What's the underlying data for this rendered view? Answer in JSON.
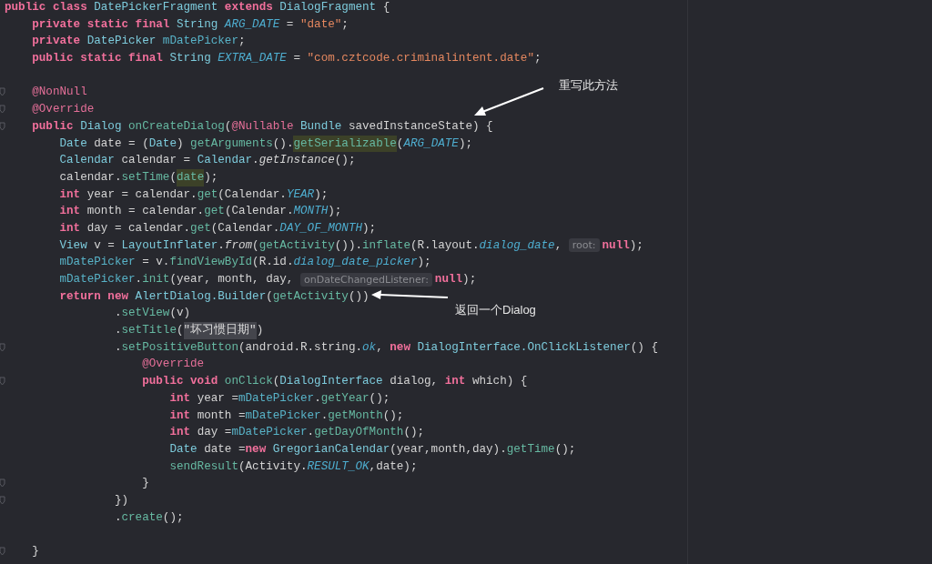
{
  "editor": {
    "lines": [
      {
        "fold": false,
        "tokens": [
          {
            "text": "public class ",
            "kind": "kw"
          },
          {
            "text": "DatePickerFragment ",
            "kind": "type"
          },
          {
            "text": "extends ",
            "kind": "kw"
          },
          {
            "text": "DialogFragment ",
            "kind": "type"
          },
          {
            "text": "{",
            "kind": "plain"
          }
        ]
      },
      {
        "fold": false,
        "tokens": [
          {
            "text": "    private static final ",
            "kind": "kw"
          },
          {
            "text": "String ",
            "kind": "type"
          },
          {
            "text": "ARG_DATE",
            "kind": "const"
          },
          {
            "text": " = ",
            "kind": "plain"
          },
          {
            "text": "\"date\"",
            "kind": "str"
          },
          {
            "text": ";",
            "kind": "plain"
          }
        ]
      },
      {
        "fold": false,
        "tokens": [
          {
            "text": "    private ",
            "kind": "kw"
          },
          {
            "text": "DatePicker ",
            "kind": "type"
          },
          {
            "text": "mDatePicker",
            "kind": "field"
          },
          {
            "text": ";",
            "kind": "plain"
          }
        ]
      },
      {
        "fold": false,
        "tokens": [
          {
            "text": "    public static final ",
            "kind": "kw"
          },
          {
            "text": "String ",
            "kind": "type"
          },
          {
            "text": "EXTRA_DATE",
            "kind": "const"
          },
          {
            "text": " = ",
            "kind": "plain"
          },
          {
            "text": "\"com.cztcode.criminalintent.date\"",
            "kind": "str"
          },
          {
            "text": ";",
            "kind": "plain"
          }
        ]
      },
      {
        "fold": false
      },
      {
        "fold": true,
        "tokens": [
          {
            "text": "    @NonNull",
            "kind": "anno"
          }
        ]
      },
      {
        "fold": true,
        "tokens": [
          {
            "text": "    @Override",
            "kind": "anno"
          }
        ]
      },
      {
        "fold": true,
        "tokens": [
          {
            "text": "    public ",
            "kind": "kw"
          },
          {
            "text": "Dialog ",
            "kind": "type"
          },
          {
            "text": "onCreateDialog",
            "kind": "fn"
          },
          {
            "text": "(",
            "kind": "plain"
          },
          {
            "text": "@Nullable ",
            "kind": "anno"
          },
          {
            "text": "Bundle ",
            "kind": "type"
          },
          {
            "text": "savedInstanceState) {",
            "kind": "plain"
          }
        ]
      },
      {
        "fold": false,
        "tokens": [
          {
            "text": "        Date ",
            "kind": "type"
          },
          {
            "text": "date = (",
            "kind": "plain"
          },
          {
            "text": "Date",
            "kind": "type"
          },
          {
            "text": ") ",
            "kind": "plain"
          },
          {
            "text": "getArguments",
            "kind": "fn"
          },
          {
            "text": "().",
            "kind": "plain"
          },
          {
            "text": "getSerializable",
            "kind": "match"
          },
          {
            "text": "(",
            "kind": "plain"
          },
          {
            "text": "ARG_DATE",
            "kind": "const"
          },
          {
            "text": ");",
            "kind": "plain"
          }
        ]
      },
      {
        "fold": false,
        "tokens": [
          {
            "text": "        Calendar ",
            "kind": "type"
          },
          {
            "text": "calendar = ",
            "kind": "plain"
          },
          {
            "text": "Calendar",
            "kind": "type"
          },
          {
            "text": ".",
            "kind": "plain"
          },
          {
            "text": "getInstance",
            "kind": "static"
          },
          {
            "text": "();",
            "kind": "plain"
          }
        ]
      },
      {
        "fold": false,
        "tokens": [
          {
            "text": "        calendar.",
            "kind": "plain"
          },
          {
            "text": "setTime",
            "kind": "fn"
          },
          {
            "text": "(",
            "kind": "plain"
          },
          {
            "text": "date",
            "kind": "match"
          },
          {
            "text": ");",
            "kind": "plain"
          }
        ]
      },
      {
        "fold": false,
        "tokens": [
          {
            "text": "        int ",
            "kind": "kw"
          },
          {
            "text": "year = calendar.",
            "kind": "plain"
          },
          {
            "text": "get",
            "kind": "fn"
          },
          {
            "text": "(Calendar.",
            "kind": "plain"
          },
          {
            "text": "YEAR",
            "kind": "const"
          },
          {
            "text": ");",
            "kind": "plain"
          }
        ]
      },
      {
        "fold": false,
        "tokens": [
          {
            "text": "        int ",
            "kind": "kw"
          },
          {
            "text": "month = calendar.",
            "kind": "plain"
          },
          {
            "text": "get",
            "kind": "fn"
          },
          {
            "text": "(Calendar.",
            "kind": "plain"
          },
          {
            "text": "MONTH",
            "kind": "const"
          },
          {
            "text": ");",
            "kind": "plain"
          }
        ]
      },
      {
        "fold": false,
        "tokens": [
          {
            "text": "        int ",
            "kind": "kw"
          },
          {
            "text": "day = calendar.",
            "kind": "plain"
          },
          {
            "text": "get",
            "kind": "fn"
          },
          {
            "text": "(Calendar.",
            "kind": "plain"
          },
          {
            "text": "DAY_OF_MONTH",
            "kind": "const"
          },
          {
            "text": ");",
            "kind": "plain"
          }
        ]
      },
      {
        "fold": false,
        "tokens": [
          {
            "text": "        View ",
            "kind": "type"
          },
          {
            "text": "v = ",
            "kind": "plain"
          },
          {
            "text": "LayoutInflater",
            "kind": "type"
          },
          {
            "text": ".",
            "kind": "plain"
          },
          {
            "text": "from",
            "kind": "static"
          },
          {
            "text": "(",
            "kind": "plain"
          },
          {
            "text": "getActivity",
            "kind": "fn"
          },
          {
            "text": "()).",
            "kind": "plain"
          },
          {
            "text": "inflate",
            "kind": "fn"
          },
          {
            "text": "(R.layout.",
            "kind": "plain"
          },
          {
            "text": "dialog_date",
            "kind": "const"
          },
          {
            "text": ", ",
            "kind": "plain"
          },
          {
            "text": "root:",
            "kind": "hint"
          },
          {
            "text": "null",
            "kind": "kw"
          },
          {
            "text": ");",
            "kind": "plain"
          }
        ]
      },
      {
        "fold": false,
        "tokens": [
          {
            "text": "        mDatePicker",
            "kind": "field"
          },
          {
            "text": " = v.",
            "kind": "plain"
          },
          {
            "text": "findViewById",
            "kind": "fn"
          },
          {
            "text": "(R.id.",
            "kind": "plain"
          },
          {
            "text": "dialog_date_picker",
            "kind": "const"
          },
          {
            "text": ");",
            "kind": "plain"
          }
        ]
      },
      {
        "fold": false,
        "tokens": [
          {
            "text": "        mDatePicker",
            "kind": "field"
          },
          {
            "text": ".",
            "kind": "plain"
          },
          {
            "text": "init",
            "kind": "fn"
          },
          {
            "text": "(year, month, day, ",
            "kind": "plain"
          },
          {
            "text": "onDateChangedListener:",
            "kind": "hint"
          },
          {
            "text": "null",
            "kind": "kw"
          },
          {
            "text": ");",
            "kind": "plain"
          }
        ]
      },
      {
        "fold": false,
        "tokens": [
          {
            "text": "        return new ",
            "kind": "kw"
          },
          {
            "text": "AlertDialog.Builder",
            "kind": "type"
          },
          {
            "text": "(",
            "kind": "plain"
          },
          {
            "text": "getActivity",
            "kind": "fn"
          },
          {
            "text": "())",
            "kind": "plain"
          }
        ]
      },
      {
        "fold": false,
        "tokens": [
          {
            "text": "                .",
            "kind": "plain"
          },
          {
            "text": "setView",
            "kind": "fn"
          },
          {
            "text": "(v)",
            "kind": "plain"
          }
        ]
      },
      {
        "fold": false,
        "tokens": [
          {
            "text": "                .",
            "kind": "plain"
          },
          {
            "text": "setTitle",
            "kind": "fn"
          },
          {
            "text": "(",
            "kind": "plain"
          },
          {
            "text": "\"坏习惯日期\"",
            "kind": "selected-str"
          },
          {
            "text": ")",
            "kind": "plain"
          }
        ]
      },
      {
        "fold": true,
        "tokens": [
          {
            "text": "                .",
            "kind": "plain"
          },
          {
            "text": "setPositiveButton",
            "kind": "fn"
          },
          {
            "text": "(android.R.string.",
            "kind": "plain"
          },
          {
            "text": "ok",
            "kind": "const"
          },
          {
            "text": ", ",
            "kind": "plain"
          },
          {
            "text": "new ",
            "kind": "kw"
          },
          {
            "text": "DialogInterface.OnClickListener",
            "kind": "type"
          },
          {
            "text": "() {",
            "kind": "plain"
          }
        ]
      },
      {
        "fold": false,
        "tokens": [
          {
            "text": "                    @Override",
            "kind": "anno"
          }
        ]
      },
      {
        "fold": true,
        "tokens": [
          {
            "text": "                    public void ",
            "kind": "kw"
          },
          {
            "text": "onClick",
            "kind": "fn"
          },
          {
            "text": "(",
            "kind": "plain"
          },
          {
            "text": "DialogInterface ",
            "kind": "type"
          },
          {
            "text": "dialog, ",
            "kind": "plain"
          },
          {
            "text": "int ",
            "kind": "kw"
          },
          {
            "text": "which) {",
            "kind": "plain"
          }
        ]
      },
      {
        "fold": false,
        "tokens": [
          {
            "text": "                        int ",
            "kind": "kw"
          },
          {
            "text": "year =",
            "kind": "plain"
          },
          {
            "text": "mDatePicker",
            "kind": "field"
          },
          {
            "text": ".",
            "kind": "plain"
          },
          {
            "text": "getYear",
            "kind": "fn"
          },
          {
            "text": "();",
            "kind": "plain"
          }
        ]
      },
      {
        "fold": false,
        "tokens": [
          {
            "text": "                        int ",
            "kind": "kw"
          },
          {
            "text": "month =",
            "kind": "plain"
          },
          {
            "text": "mDatePicker",
            "kind": "field"
          },
          {
            "text": ".",
            "kind": "plain"
          },
          {
            "text": "getMonth",
            "kind": "fn"
          },
          {
            "text": "();",
            "kind": "plain"
          }
        ]
      },
      {
        "fold": false,
        "tokens": [
          {
            "text": "                        int ",
            "kind": "kw"
          },
          {
            "text": "day =",
            "kind": "plain"
          },
          {
            "text": "mDatePicker",
            "kind": "field"
          },
          {
            "text": ".",
            "kind": "plain"
          },
          {
            "text": "getDayOfMonth",
            "kind": "fn"
          },
          {
            "text": "();",
            "kind": "plain"
          }
        ]
      },
      {
        "fold": false,
        "tokens": [
          {
            "text": "                        Date ",
            "kind": "type"
          },
          {
            "text": "date =",
            "kind": "plain"
          },
          {
            "text": "new ",
            "kind": "kw"
          },
          {
            "text": "GregorianCalendar",
            "kind": "type"
          },
          {
            "text": "(year,month,day).",
            "kind": "plain"
          },
          {
            "text": "getTime",
            "kind": "fn"
          },
          {
            "text": "();",
            "kind": "plain"
          }
        ]
      },
      {
        "fold": false,
        "tokens": [
          {
            "text": "                        sendResult",
            "kind": "fn"
          },
          {
            "text": "(Activity.",
            "kind": "plain"
          },
          {
            "text": "RESULT_OK",
            "kind": "const"
          },
          {
            "text": ",date);",
            "kind": "plain"
          }
        ]
      },
      {
        "fold": true,
        "tokens": [
          {
            "text": "                    }",
            "kind": "plain"
          }
        ]
      },
      {
        "fold": true,
        "tokens": [
          {
            "text": "                })",
            "kind": "plain"
          }
        ]
      },
      {
        "fold": false,
        "tokens": [
          {
            "text": "                .",
            "kind": "plain"
          },
          {
            "text": "create",
            "kind": "fn"
          },
          {
            "text": "();",
            "kind": "plain"
          }
        ]
      },
      {
        "fold": false
      },
      {
        "fold": true,
        "tokens": [
          {
            "text": "    }",
            "kind": "plain"
          }
        ]
      }
    ]
  },
  "callouts": [
    {
      "text": "重写此方法"
    },
    {
      "text": "返回一个Dialog"
    }
  ]
}
